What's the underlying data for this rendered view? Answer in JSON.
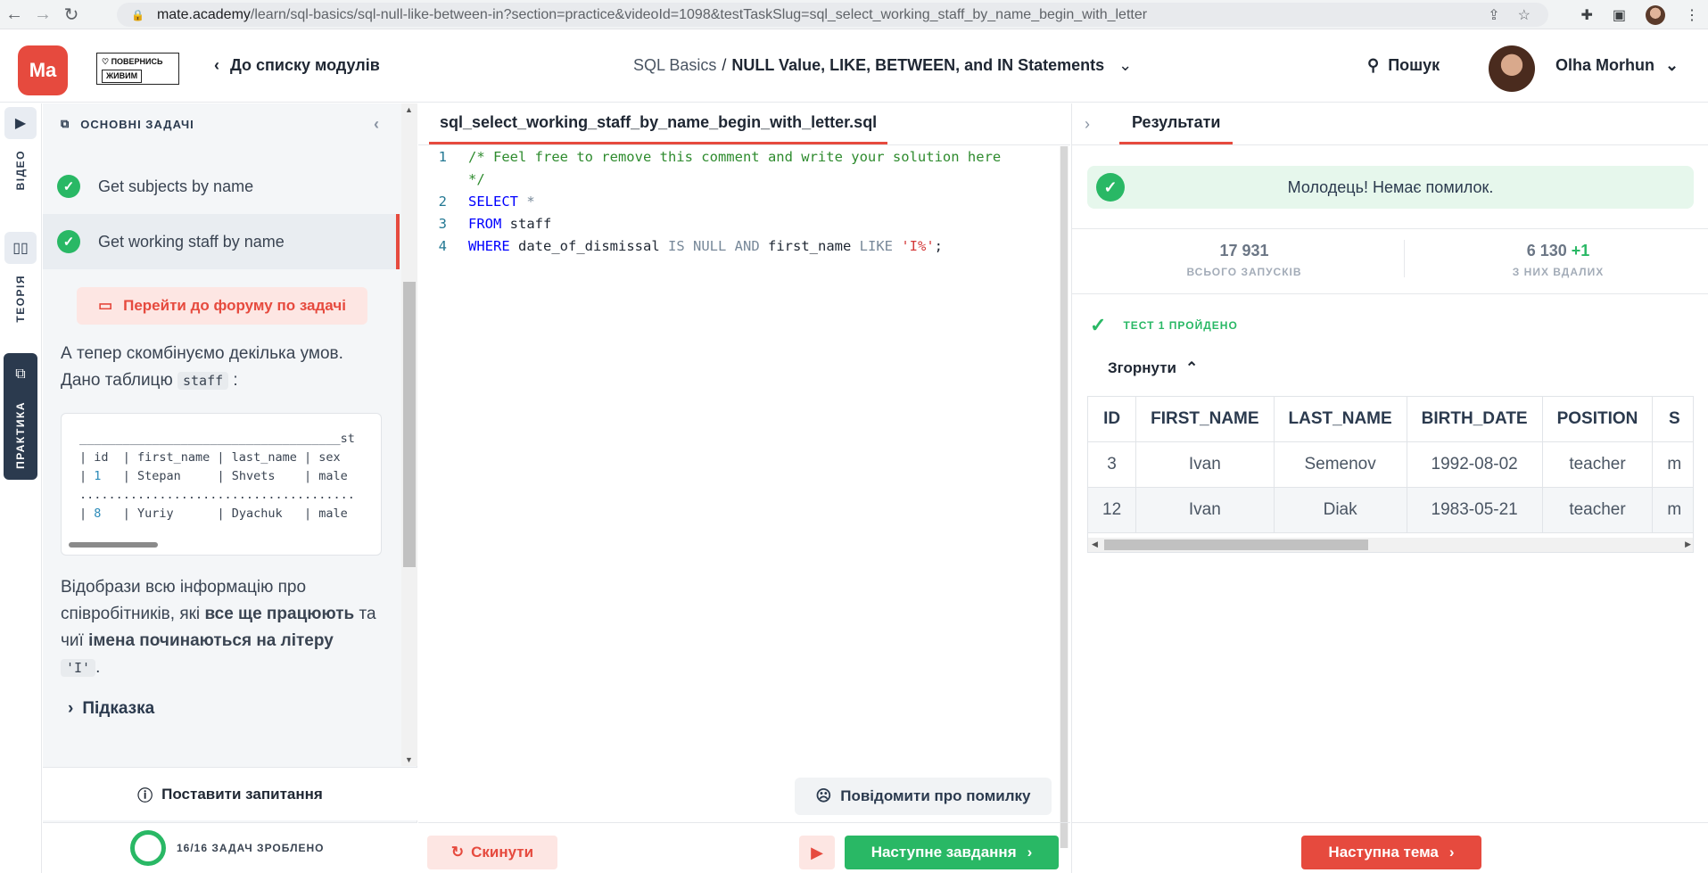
{
  "browser": {
    "url_host": "mate.academy",
    "url_rest": "/learn/sql-basics/sql-null-like-between-in?section=practice&videoId=1098&testTaskSlug=sql_select_working_staff_by_name_begin_with_letter"
  },
  "header": {
    "logo_text": "Ma",
    "brand_line1": "♡ ПОВЕРНИСЬ",
    "brand_line2": "ЖИВИМ",
    "back_label": "До списку модулів",
    "course": "SQL Basics",
    "separator": "/",
    "module": "NULL Value, LIKE, BETWEEN, and IN Statements",
    "search_label": "Пошук",
    "user_name": "Olha Morhun"
  },
  "rail": {
    "video_label": "ВІДЕО",
    "theory_label": "ТЕОРІЯ",
    "practice_label": "ПРАКТИКА"
  },
  "tasks": {
    "section_title": "ОСНОВНІ ЗАДАЧІ",
    "items": [
      {
        "label": "Get subjects by name"
      },
      {
        "label": "Get working staff by name"
      }
    ],
    "forum_button": "Перейти до форуму по задачі",
    "intro_line1": "А тепер скомбінуємо декілька умов.",
    "intro_line2": "Дано таблицю",
    "intro_code": "staff",
    "intro_colon": ":",
    "table_preview": {
      "top_rule": "____________________________________st",
      "header": "| id  | first_name | last_name | sex",
      "row1_a": "| ",
      "row1_num": "1",
      "row1_b": "   | Stepan     | Shvets    | male",
      "dots": "......................................",
      "row2_a": "| ",
      "row2_num": "8",
      "row2_b": "   | Yuriy      | Dyachuk   | male"
    },
    "task_p1": "Відобрази всю інформацію про співробітників, які ",
    "task_b1": "все ще працюють",
    "task_p2": " та чиї ",
    "task_b2": "імена починаються на літеру",
    "task_code": "'I'",
    "task_end": ".",
    "hint_label": "Підказка",
    "ask_label": "Поставити запитання",
    "progress_label": "16/16 ЗАДАЧ ЗРОБЛЕНО"
  },
  "editor": {
    "filename": "sql_select_working_staff_by_name_begin_with_letter.sql",
    "line_numbers": [
      "1",
      "2",
      "3",
      "4"
    ],
    "line1a": "/* Feel free to remove this comment and write your solution here",
    "line1b": "*/",
    "l2_kw": "SELECT",
    "l2_op": "*",
    "l3_kw": "FROM",
    "l3_id": "staff",
    "l4_kw": "WHERE",
    "l4_id1": "date_of_dismissal",
    "l4_op1": "IS NULL AND",
    "l4_id2": "first_name",
    "l4_op2": "LIKE",
    "l4_str": "'I%'",
    "l4_end": ";",
    "report_label": "Повідомити про помилку",
    "reset_label": "Скинути",
    "next_task_label": "Наступне завдання"
  },
  "results": {
    "tab_label": "Результати",
    "success_msg": "Молодець! Немає помилок.",
    "total_runs_value": "17 931",
    "total_runs_label": "ВСЬОГО ЗАПУСКІВ",
    "success_runs_value": "6 130",
    "success_runs_plus": "+1",
    "success_runs_label": "З НИХ ВДАЛИХ",
    "test_label": "ТЕСТ 1 ПРОЙДЕНО",
    "collapse_label": "Згорнути",
    "columns": [
      "ID",
      "FIRST_NAME",
      "LAST_NAME",
      "BIRTH_DATE",
      "POSITION",
      "S"
    ],
    "rows": [
      [
        "3",
        "Ivan",
        "Semenov",
        "1992-08-02",
        "teacher",
        "m"
      ],
      [
        "12",
        "Ivan",
        "Diak",
        "1983-05-21",
        "teacher",
        "m"
      ]
    ],
    "next_topic_label": "Наступна тема"
  },
  "colors": {
    "brand_red": "#e64a3e",
    "success_green": "#29b865",
    "rail_dark": "#2b3a4e"
  }
}
